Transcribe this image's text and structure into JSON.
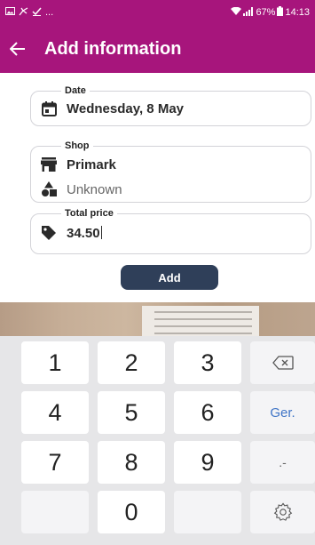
{
  "status_bar": {
    "left_icons": [
      "image-icon",
      "share-icon",
      "check-icon"
    ],
    "ellipsis": "...",
    "battery": "67%",
    "time": "14:13"
  },
  "app_bar": {
    "title": "Add information",
    "back_icon": "arrow-left-icon"
  },
  "form": {
    "date": {
      "label": "Date",
      "value": "Wednesday, 8 May",
      "icon": "calendar-icon"
    },
    "shop": {
      "label": "Shop",
      "name": "Primark",
      "name_icon": "store-icon",
      "category": "Unknown",
      "category_icon": "shapes-icon"
    },
    "total_price": {
      "label": "Total price",
      "value": "34.50",
      "icon": "tag-icon"
    },
    "add_label": "Add"
  },
  "keyboard": {
    "keys": [
      "1",
      "2",
      "3",
      "4",
      "5",
      "6",
      "7",
      "8",
      "9",
      "0"
    ],
    "go_label": "Ger.",
    "symbol_label": ".-",
    "backspace_icon": "backspace-icon",
    "settings_icon": "gear-icon"
  },
  "colors": {
    "accent": "#a7157c",
    "button": "#2f3f59",
    "go_key": "#3f74c6"
  }
}
